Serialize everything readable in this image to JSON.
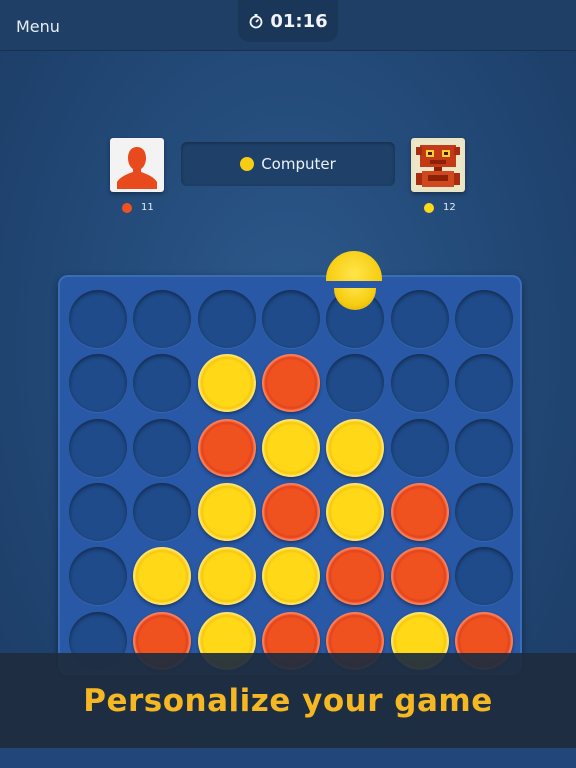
{
  "header": {
    "menu_label": "Menu",
    "timer": "01:16",
    "timer_icon": "stopwatch-icon"
  },
  "players": {
    "current_turn": {
      "name": "Computer",
      "color": "yellow"
    },
    "left": {
      "score": "11",
      "color": "red",
      "avatar": "person-silhouette-icon"
    },
    "right": {
      "score": "12",
      "color": "yellow",
      "avatar": "robot-icon"
    }
  },
  "board": {
    "columns": 7,
    "rows": 6,
    "cells": [
      [
        "empty",
        "empty",
        "empty",
        "empty",
        "empty",
        "empty",
        "empty"
      ],
      [
        "empty",
        "empty",
        "yellow",
        "red",
        "empty",
        "empty",
        "empty"
      ],
      [
        "empty",
        "empty",
        "red",
        "yellow",
        "yellow",
        "empty",
        "empty"
      ],
      [
        "empty",
        "empty",
        "yellow",
        "red",
        "yellow",
        "red",
        "empty"
      ],
      [
        "empty",
        "yellow",
        "yellow",
        "yellow",
        "red",
        "red",
        "empty"
      ],
      [
        "empty",
        "red",
        "yellow",
        "red",
        "red",
        "yellow",
        "red"
      ]
    ],
    "dropping_disc_color": "yellow",
    "dropping_disc_column": 4
  },
  "colors": {
    "red": "#f0521f",
    "yellow": "#ffd817",
    "board": "#2858a6",
    "banner_text": "#f5b823"
  },
  "banner": {
    "text": "Personalize your game"
  }
}
